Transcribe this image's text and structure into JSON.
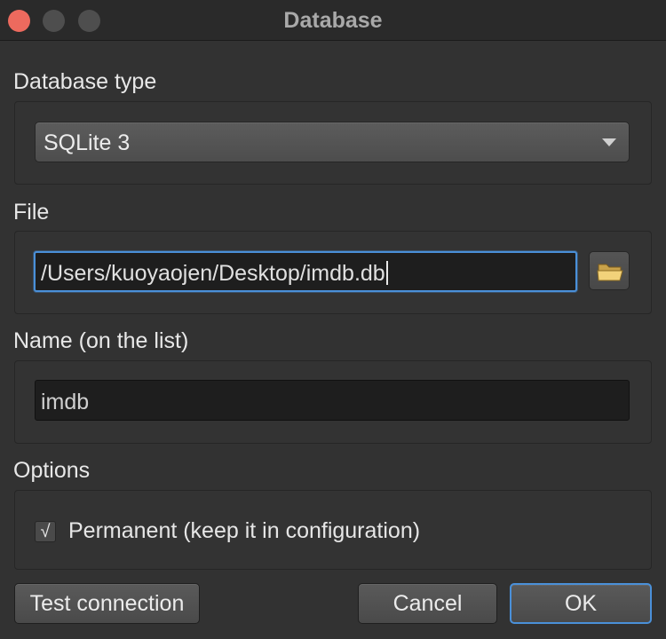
{
  "window": {
    "title": "Database"
  },
  "sections": {
    "db_type": {
      "heading": "Database type",
      "selected": "SQLite 3"
    },
    "file": {
      "heading": "File",
      "path": "/Users/kuoyaojen/Desktop/imdb.db",
      "browse_icon": "folder-icon"
    },
    "name": {
      "heading": "Name (on the list)",
      "value": "imdb"
    },
    "options": {
      "heading": "Options",
      "permanent_label": "Permanent (keep it in configuration)",
      "permanent_checked": true,
      "check_glyph": "√"
    }
  },
  "buttons": {
    "test": "Test connection",
    "cancel": "Cancel",
    "ok": "OK"
  },
  "colors": {
    "accent": "#4a90d9",
    "close": "#ed6a5e",
    "background": "#323232"
  }
}
